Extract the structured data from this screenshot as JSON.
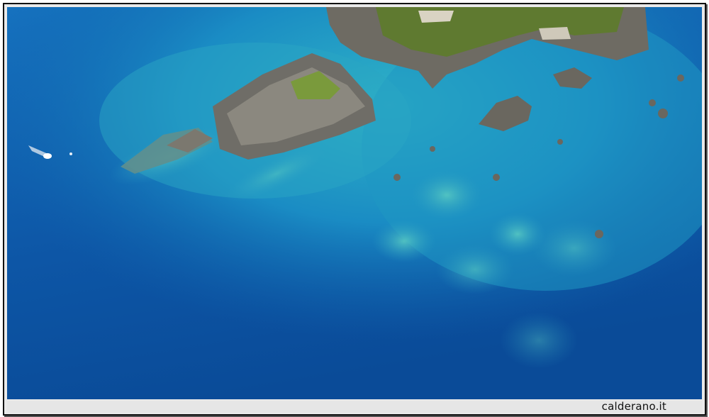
{
  "caption": {
    "site": "calderano.it"
  },
  "photo": {
    "subject": "aerial-sea-rocks",
    "colors": {
      "deep_sea": "#0b4fa0",
      "mid_sea": "#1676c2",
      "shallow_sea": "#2aa6c4",
      "reef": "#4fc2c0",
      "rock": "#7d7a72",
      "vegetation": "#6f8a3a"
    }
  }
}
